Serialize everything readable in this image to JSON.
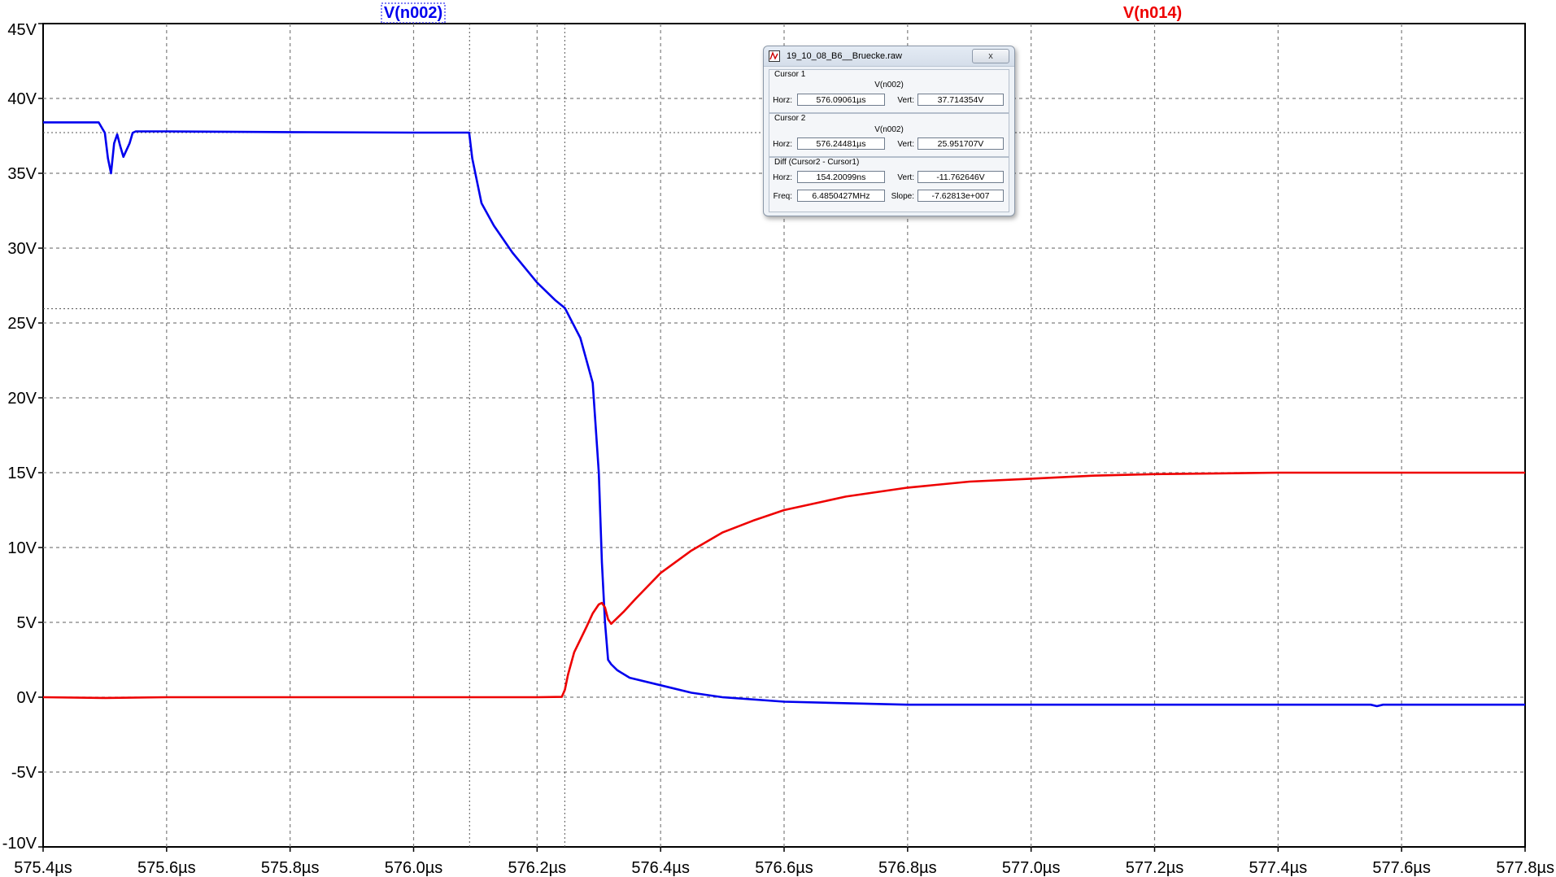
{
  "chart_data": {
    "type": "line",
    "title": "",
    "xlabel": "",
    "ylabel": "",
    "xlim": [
      575.4,
      577.8
    ],
    "ylim": [
      -10,
      45
    ],
    "x_ticks": [
      575.4,
      575.6,
      575.8,
      576.0,
      576.2,
      576.4,
      576.6,
      576.8,
      577.0,
      577.2,
      577.4,
      577.6,
      577.8
    ],
    "x_tick_labels": [
      "575.4µs",
      "575.6µs",
      "575.8µs",
      "576.0µs",
      "576.2µs",
      "576.4µs",
      "576.6µs",
      "576.8µs",
      "577.0µs",
      "577.2µs",
      "577.4µs",
      "577.6µs",
      "577.8µs"
    ],
    "y_ticks": [
      45,
      40,
      35,
      30,
      25,
      20,
      15,
      10,
      5,
      0,
      -5,
      -10
    ],
    "y_tick_labels": [
      "45V",
      "40V",
      "35V",
      "30V",
      "25V",
      "20V",
      "15V",
      "10V",
      "5V",
      "0V",
      "-5V",
      "-10V"
    ],
    "grid": true,
    "cursor_lines": {
      "x": [
        576.09061,
        576.24481
      ],
      "y": [
        37.714354,
        25.951707
      ]
    },
    "series": [
      {
        "name": "V(n002)",
        "color": "#0000ee",
        "x": [
          575.4,
          575.49,
          575.5,
          575.505,
          575.51,
          575.515,
          575.52,
          575.525,
          575.53,
          575.54,
          575.545,
          575.55,
          575.6,
          575.8,
          576.0,
          576.09,
          576.095,
          576.1,
          576.11,
          576.13,
          576.16,
          576.2,
          576.23,
          576.245,
          576.27,
          576.29,
          576.3,
          576.305,
          576.31,
          576.315,
          576.32,
          576.33,
          576.35,
          576.4,
          576.45,
          576.5,
          576.6,
          576.8,
          577.0,
          577.2,
          577.4,
          577.55,
          577.56,
          577.57,
          577.6,
          577.8
        ],
        "y": [
          38.4,
          38.4,
          37.7,
          36.0,
          35.0,
          37.0,
          37.6,
          36.8,
          36.1,
          37.0,
          37.7,
          37.8,
          37.8,
          37.75,
          37.72,
          37.72,
          36.0,
          35.0,
          33.0,
          31.5,
          29.7,
          27.7,
          26.5,
          26.0,
          24.0,
          21.0,
          15.0,
          9.0,
          5.0,
          2.5,
          2.2,
          1.8,
          1.3,
          0.8,
          0.3,
          0.0,
          -0.3,
          -0.5,
          -0.5,
          -0.5,
          -0.5,
          -0.5,
          -0.6,
          -0.5,
          -0.5,
          -0.5
        ]
      },
      {
        "name": "V(n014)",
        "color": "#ee0000",
        "x": [
          575.4,
          575.5,
          575.6,
          575.8,
          576.0,
          576.2,
          576.24,
          576.245,
          576.25,
          576.26,
          576.28,
          576.29,
          576.3,
          576.305,
          576.31,
          576.315,
          576.32,
          576.34,
          576.36,
          576.4,
          576.45,
          576.5,
          576.55,
          576.6,
          576.7,
          576.8,
          576.9,
          577.0,
          577.1,
          577.2,
          577.3,
          577.4,
          577.6,
          577.8
        ],
        "y": [
          0,
          -0.05,
          0,
          0,
          0,
          0,
          0.02,
          0.5,
          1.5,
          3.0,
          4.7,
          5.6,
          6.2,
          6.3,
          6.0,
          5.2,
          4.9,
          5.7,
          6.6,
          8.3,
          9.8,
          11.0,
          11.8,
          12.5,
          13.4,
          14.0,
          14.4,
          14.6,
          14.8,
          14.9,
          14.95,
          15.0,
          15.0,
          15.0
        ]
      }
    ]
  },
  "cursor_window": {
    "title": "19_10_08_B6__Bruecke.raw",
    "close_label": "x",
    "cursor1": {
      "heading": "Cursor 1",
      "trace": "V(n002)",
      "horz_label": "Horz:",
      "horz": "576.09061µs",
      "vert_label": "Vert:",
      "vert": "37.714354V"
    },
    "cursor2": {
      "heading": "Cursor 2",
      "trace": "V(n002)",
      "horz_label": "Horz:",
      "horz": "576.24481µs",
      "vert_label": "Vert:",
      "vert": "25.951707V"
    },
    "diff": {
      "heading": "Diff (Cursor2 - Cursor1)",
      "horz_label": "Horz:",
      "horz": "154.20099ns",
      "vert_label": "Vert:",
      "vert": "-11.762646V",
      "freq_label": "Freq:",
      "freq": "6.4850427MHz",
      "slope_label": "Slope:",
      "slope": "-7.62813e+007"
    }
  },
  "colors": {
    "grid": "#7f7f7f",
    "axis": "#000000"
  }
}
